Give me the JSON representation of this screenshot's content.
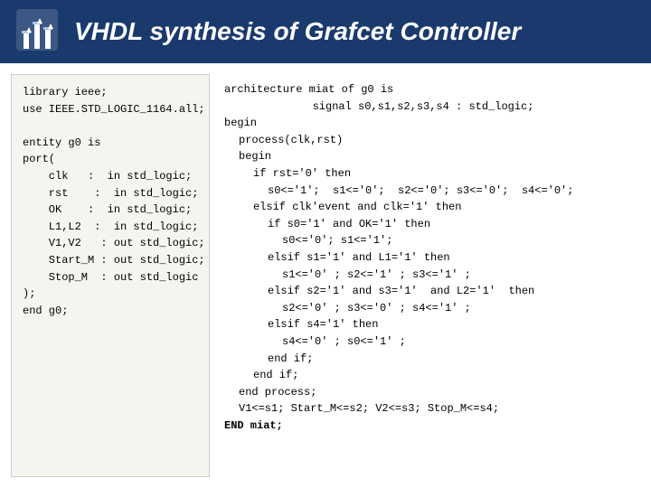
{
  "header": {
    "title": "VHDL synthesis of Grafcet Controller",
    "logo_alt": "university-logo"
  },
  "left_panel": {
    "lines": [
      "library ieee;",
      "use IEEE.STD_LOGIC_1164.all;",
      "",
      "entity g0 is",
      "port(",
      "    clk   :  in std_logic;",
      "    rst    :  in std_logic;",
      "    OK    :  in std_logic;",
      "    L1,L2  :  in std_logic;",
      "    V1,V2  :  out std_logic;",
      "    Start_M : out std_logic;",
      "    Stop_M  : out std_logic",
      ");",
      "end g0;"
    ]
  },
  "right_panel": {
    "lines": [
      {
        "text": "architecture miat of g0 is",
        "indent": 0
      },
      {
        "text": "signal s0,s1,s2,s3,s4 : std_logic;",
        "indent": 56
      },
      {
        "text": "begin",
        "indent": 0
      },
      {
        "text": "process(clk,rst)",
        "indent": 16
      },
      {
        "text": "begin",
        "indent": 16
      },
      {
        "text": "if rst='0' then",
        "indent": 32
      },
      {
        "text": "s0<='1';  s1<='0';  s2<='0'; s3<='0';  s4<='0';",
        "indent": 48
      },
      {
        "text": "elsif clk'event and clk='1' then",
        "indent": 32
      },
      {
        "text": "if s0='1' and OK='1' then",
        "indent": 48
      },
      {
        "text": "s0<='0'; s1<='1';",
        "indent": 64
      },
      {
        "text": "elsif s1='1' and L1='1' then",
        "indent": 48
      },
      {
        "text": "s1<='0' ; s2<='1' ; s3<='1' ;",
        "indent": 64
      },
      {
        "text": "elsif s2='1' and s3='1'  and L2='1'  then",
        "indent": 48
      },
      {
        "text": "s2<='0' ; s3<='0' ; s4<='1' ;",
        "indent": 64
      },
      {
        "text": "elsif s4='1' then",
        "indent": 48
      },
      {
        "text": "s4<='0' ; s0<='1' ;",
        "indent": 64
      },
      {
        "text": "end if;",
        "indent": 48
      },
      {
        "text": "end if;",
        "indent": 32
      },
      {
        "text": "end process;",
        "indent": 16
      },
      {
        "text": "V1<=s1; Start_M<=s2; V2<=s3; Stop_M<=s4;",
        "indent": 16
      },
      {
        "text": "END miat;",
        "indent": 0
      }
    ]
  }
}
